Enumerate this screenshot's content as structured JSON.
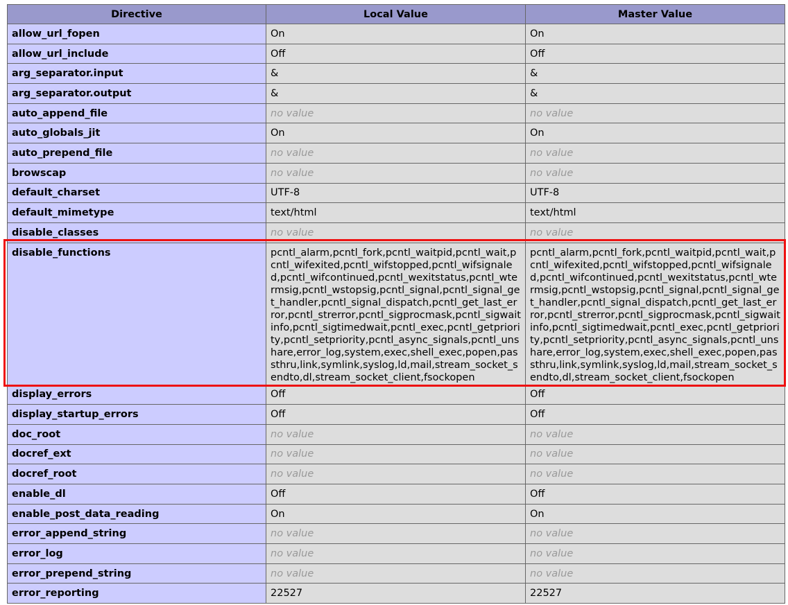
{
  "columns": {
    "directive": "Directive",
    "local": "Local Value",
    "master": "Master Value"
  },
  "rows": [
    {
      "name": "allow_url_fopen",
      "local": "On",
      "master": "On"
    },
    {
      "name": "allow_url_include",
      "local": "Off",
      "master": "Off"
    },
    {
      "name": "arg_separator.input",
      "local": "&",
      "master": "&"
    },
    {
      "name": "arg_separator.output",
      "local": "&",
      "master": "&"
    },
    {
      "name": "auto_append_file",
      "local": "no value",
      "master": "no value"
    },
    {
      "name": "auto_globals_jit",
      "local": "On",
      "master": "On"
    },
    {
      "name": "auto_prepend_file",
      "local": "no value",
      "master": "no value"
    },
    {
      "name": "browscap",
      "local": "no value",
      "master": "no value"
    },
    {
      "name": "default_charset",
      "local": "UTF-8",
      "master": "UTF-8"
    },
    {
      "name": "default_mimetype",
      "local": "text/html",
      "master": "text/html"
    },
    {
      "name": "disable_classes",
      "local": "no value",
      "master": "no value"
    },
    {
      "name": "disable_functions",
      "local": "pcntl_alarm,pcntl_fork,pcntl_waitpid,pcntl_wait,pcntl_wifexited,pcntl_wifstopped,pcntl_wifsignaled,pcntl_wifcontinued,pcntl_wexitstatus,pcntl_wtermsig,pcntl_wstopsig,pcntl_signal,pcntl_signal_get_handler,pcntl_signal_dispatch,pcntl_get_last_error,pcntl_strerror,pcntl_sigprocmask,pcntl_sigwaitinfo,pcntl_sigtimedwait,pcntl_exec,pcntl_getpriority,pcntl_setpriority,pcntl_async_signals,pcntl_unshare,error_log,system,exec,shell_exec,popen,passthru,link,symlink,syslog,ld,mail,stream_socket_sendto,dl,stream_socket_client,fsockopen",
      "master": "pcntl_alarm,pcntl_fork,pcntl_waitpid,pcntl_wait,pcntl_wifexited,pcntl_wifstopped,pcntl_wifsignaled,pcntl_wifcontinued,pcntl_wexitstatus,pcntl_wtermsig,pcntl_wstopsig,pcntl_signal,pcntl_signal_get_handler,pcntl_signal_dispatch,pcntl_get_last_error,pcntl_strerror,pcntl_sigprocmask,pcntl_sigwaitinfo,pcntl_sigtimedwait,pcntl_exec,pcntl_getpriority,pcntl_setpriority,pcntl_async_signals,pcntl_unshare,error_log,system,exec,shell_exec,popen,passthru,link,symlink,syslog,ld,mail,stream_socket_sendto,dl,stream_socket_client,fsockopen",
      "highlighted": true
    },
    {
      "name": "display_errors",
      "local": "Off",
      "master": "Off"
    },
    {
      "name": "display_startup_errors",
      "local": "Off",
      "master": "Off"
    },
    {
      "name": "doc_root",
      "local": "no value",
      "master": "no value"
    },
    {
      "name": "docref_ext",
      "local": "no value",
      "master": "no value"
    },
    {
      "name": "docref_root",
      "local": "no value",
      "master": "no value"
    },
    {
      "name": "enable_dl",
      "local": "Off",
      "master": "Off"
    },
    {
      "name": "enable_post_data_reading",
      "local": "On",
      "master": "On"
    },
    {
      "name": "error_append_string",
      "local": "no value",
      "master": "no value"
    },
    {
      "name": "error_log",
      "local": "no value",
      "master": "no value"
    },
    {
      "name": "error_prepend_string",
      "local": "no value",
      "master": "no value"
    },
    {
      "name": "error_reporting",
      "local": "22527",
      "master": "22527"
    }
  ],
  "colors": {
    "header_bg": "#9999cc",
    "directive_bg": "#ccccff",
    "value_bg": "#dddddd",
    "no_value_text": "#999999",
    "highlight_border": "#ee1111"
  }
}
